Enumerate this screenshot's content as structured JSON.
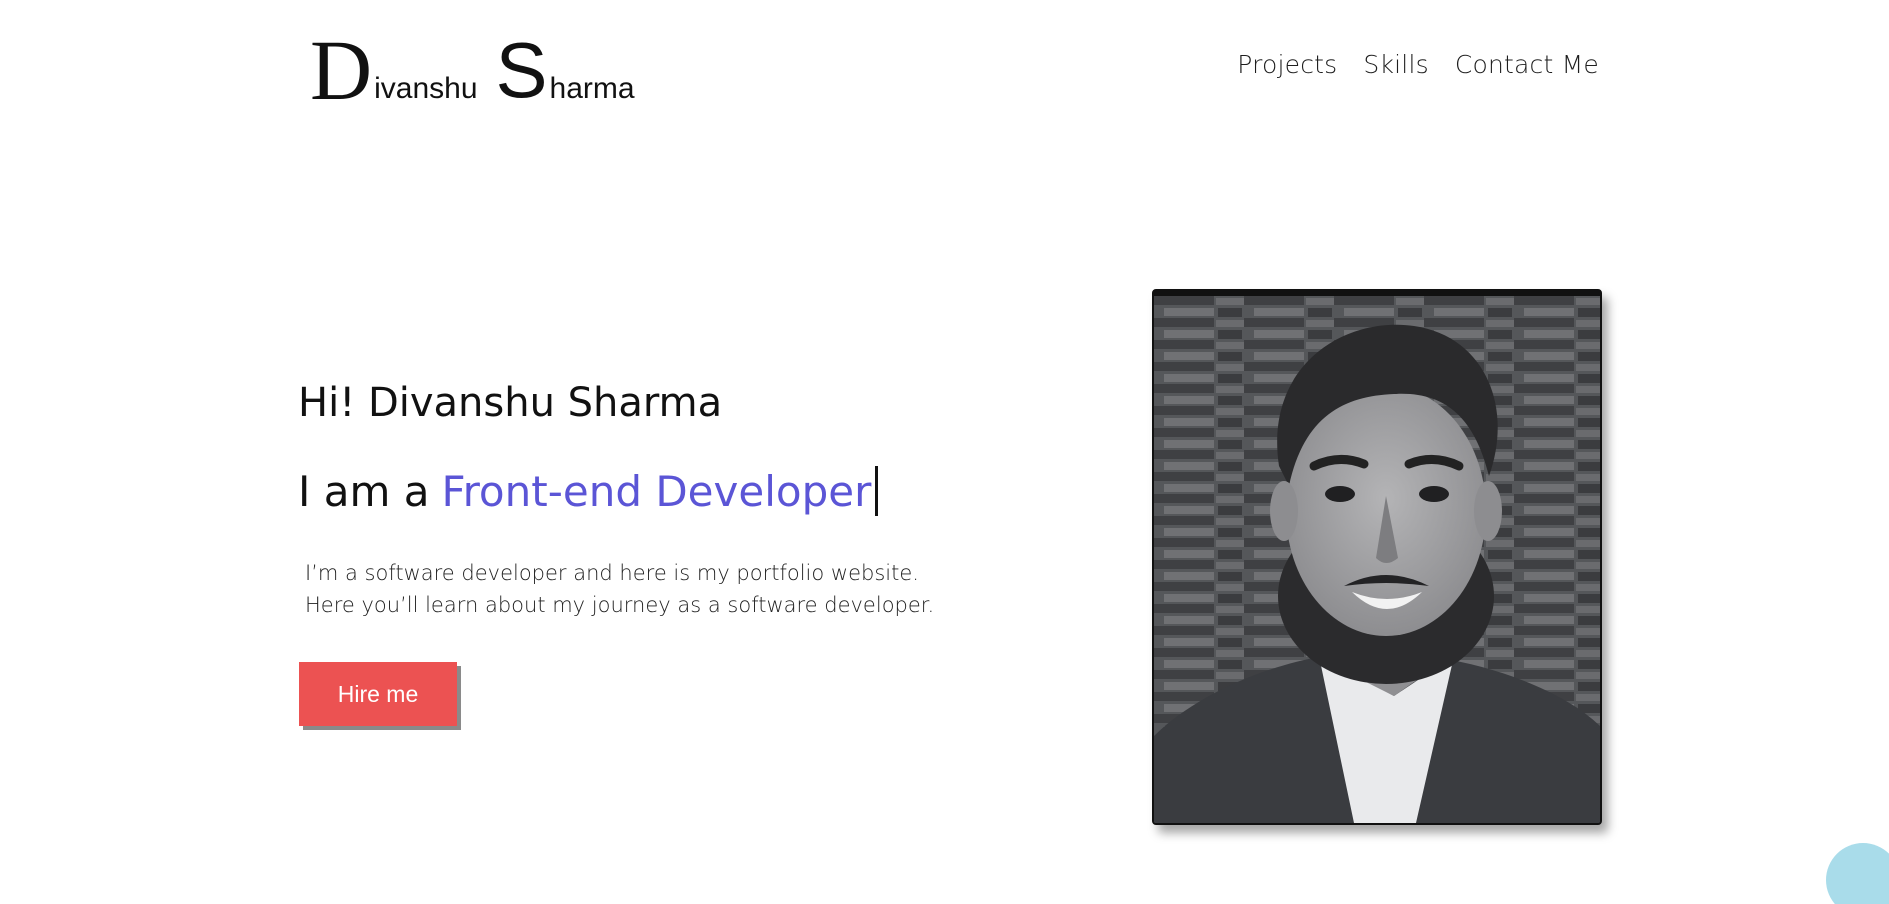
{
  "logo": {
    "first_initial": "D",
    "first_rest": "ivanshu",
    "last_initial": "S",
    "last_rest": "harma"
  },
  "nav": {
    "items": [
      "Projects",
      "Skills",
      "Contact Me"
    ]
  },
  "hero": {
    "greeting": "Hi! Divanshu Sharma",
    "role_prefix": "I am a",
    "role": "Front-end Developer",
    "intro_line_1": "I’m a software developer and here is my portfolio website.",
    "intro_line_2": "Here you’ll learn about my journey as a software developer.",
    "cta_label": "Hire me"
  },
  "colors": {
    "accent": "#5b55d6",
    "cta": "#ec5252",
    "bubble": "#a9dcea"
  }
}
